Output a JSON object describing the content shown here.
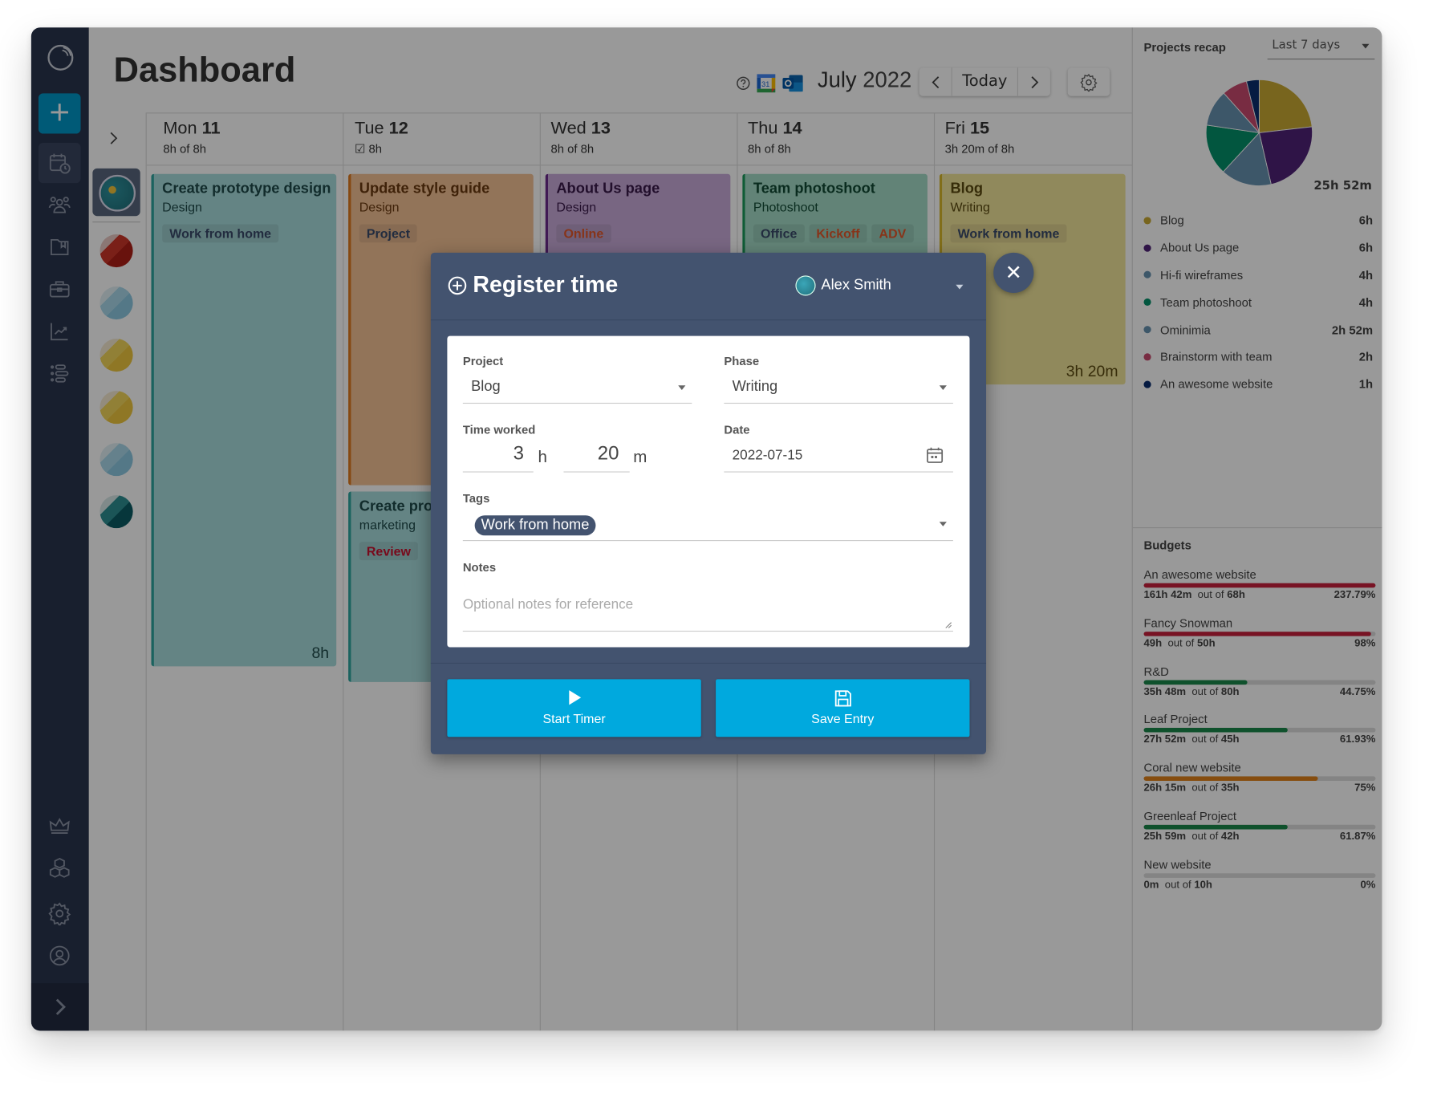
{
  "header": {
    "title": "Dashboard",
    "month": "July",
    "year": "2022",
    "today_label": "Today",
    "icons": [
      "help-icon",
      "google-calendar-icon",
      "outlook-icon",
      "settings-icon"
    ]
  },
  "sidebar": {
    "items": [
      {
        "name": "add",
        "icon": "plus-icon"
      },
      {
        "name": "timesheet",
        "icon": "calendar-clock-icon",
        "active": true
      },
      {
        "name": "team",
        "icon": "users-icon"
      },
      {
        "name": "projects",
        "icon": "folder-bookmark-icon"
      },
      {
        "name": "clients",
        "icon": "briefcase-icon"
      },
      {
        "name": "reports",
        "icon": "chart-icon"
      },
      {
        "name": "plans",
        "icon": "list-icon"
      },
      {
        "name": "upgrade",
        "icon": "crown-icon"
      },
      {
        "name": "integrations",
        "icon": "cubes-icon"
      },
      {
        "name": "settings",
        "icon": "gear-icon"
      },
      {
        "name": "profile",
        "icon": "user-circle-icon"
      }
    ]
  },
  "days": [
    {
      "name": "Mon",
      "num": "11",
      "summary": "8h of 8h"
    },
    {
      "name": "Tue",
      "num": "12",
      "summary": "8h",
      "approved": true
    },
    {
      "name": "Wed",
      "num": "13",
      "summary": "8h of 8h"
    },
    {
      "name": "Thu",
      "num": "14",
      "summary": "8h of 8h"
    },
    {
      "name": "Fri",
      "num": "15",
      "summary": "3h 20m of 8h"
    }
  ],
  "events": [
    {
      "title": "Create prototype design",
      "phase": "Design",
      "tags": [
        {
          "label": "Work from home",
          "color": "#3a4a6a"
        }
      ],
      "duration": "8h",
      "color": "#a7dcdc",
      "border": "#2ea59e"
    },
    {
      "title": "Update style guide",
      "phase": "Design",
      "tags": [
        {
          "label": "Project",
          "color": "#3a4a6a"
        }
      ],
      "duration": "",
      "color": "#f4c195",
      "border": "#e07a1f"
    },
    {
      "title": "About Us page",
      "phase": "Design",
      "tags": [
        {
          "label": "Online",
          "color": "#e2582b"
        }
      ],
      "duration": "",
      "color": "#c8aad9",
      "border": "#6c2a8c"
    },
    {
      "title": "Team photoshoot",
      "phase": "Photoshoot",
      "tags": [
        {
          "label": "Office",
          "color": "#3a4a6a"
        },
        {
          "label": "Kickoff",
          "color": "#e2582b"
        },
        {
          "label": "ADV",
          "color": "#e2582b"
        }
      ],
      "duration": "",
      "color": "#a3dac6",
      "border": "#1a9a5a"
    },
    {
      "title": "Blog",
      "phase": "Writing",
      "tags": [
        {
          "label": "Work from home",
          "color": "#3a4a6a"
        }
      ],
      "duration": "3h 20m",
      "color": "#f1e49a",
      "border": "#d8b82a"
    },
    {
      "title": "Create prototype",
      "phase": "marketing",
      "tags": [
        {
          "label": "Review",
          "color": "#c8102e"
        }
      ],
      "duration": "",
      "color": "#a7dcdc",
      "border": "#2ea59e"
    }
  ],
  "projects_recap": {
    "title": "Projects recap",
    "range": "Last 7 days",
    "total": "25h 52m"
  },
  "chart_data": {
    "type": "pie",
    "title": "Projects recap",
    "total_label": "25h 52m",
    "categories": [
      "Blog",
      "About Us page",
      "Hi-fi wireframes",
      "Team photoshoot",
      "Ominimia",
      "Brainstorm with team",
      "An awesome website"
    ],
    "values": [
      6,
      6,
      4,
      4,
      2.87,
      2,
      1
    ],
    "value_labels": [
      "6h",
      "6h",
      "4h",
      "4h",
      "2h 52m",
      "2h",
      "1h"
    ],
    "colors": [
      "#c9a933",
      "#4f2277",
      "#6792b0",
      "#04906a",
      "#6792b0",
      "#c94a6e",
      "#0b2d6e"
    ],
    "legend": "below"
  },
  "budgets": {
    "title": "Budgets",
    "items": [
      {
        "name": "An awesome website",
        "used": "161h 42m",
        "total": "68h",
        "percent_label": "237.79%",
        "fraction": 1.0,
        "color": "#c8203c"
      },
      {
        "name": "Fancy Snowman",
        "used": "49h",
        "total": "50h",
        "percent_label": "98%",
        "fraction": 0.98,
        "color": "#c8203c"
      },
      {
        "name": "R&D",
        "used": "35h 48m",
        "total": "80h",
        "percent_label": "44.75%",
        "fraction": 0.4475,
        "color": "#19884a"
      },
      {
        "name": "Leaf Project",
        "used": "27h 52m",
        "total": "45h",
        "percent_label": "61.93%",
        "fraction": 0.6193,
        "color": "#19884a"
      },
      {
        "name": "Coral new website",
        "used": "26h 15m",
        "total": "35h",
        "percent_label": "75%",
        "fraction": 0.75,
        "color": "#e0801a"
      },
      {
        "name": "Greenleaf Project",
        "used": "25h 59m",
        "total": "42h",
        "percent_label": "61.87%",
        "fraction": 0.6187,
        "color": "#19884a"
      },
      {
        "name": "New website",
        "used": "0m",
        "total": "10h",
        "percent_label": "0%",
        "fraction": 0,
        "color": "#19884a"
      }
    ],
    "out_of_label": "out of"
  },
  "modal": {
    "title": "Register time",
    "user": "Alex Smith",
    "project_label": "Project",
    "project_value": "Blog",
    "phase_label": "Phase",
    "phase_value": "Writing",
    "time_label": "Time worked",
    "hours": "3",
    "hours_unit": "h",
    "minutes": "20",
    "minutes_unit": "m",
    "date_label": "Date",
    "date_value": "2022-07-15",
    "tags_label": "Tags",
    "tag_value": "Work from home",
    "notes_label": "Notes",
    "notes_placeholder": "Optional notes for reference",
    "start_timer": "Start Timer",
    "save_entry": "Save Entry"
  }
}
